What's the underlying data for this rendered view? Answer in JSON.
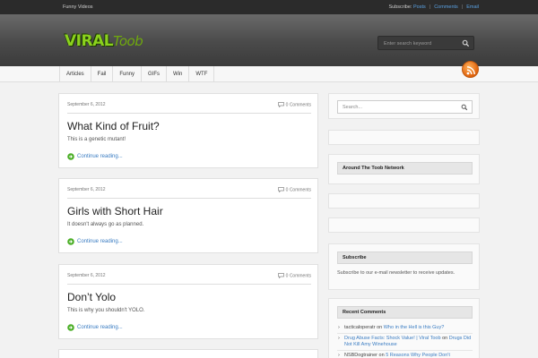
{
  "topbar": {
    "site_tag": "Funny Videos",
    "subscribe_label": "Subscribe:",
    "links": [
      "Posts",
      "Comments",
      "Email"
    ]
  },
  "header": {
    "logo_part1": "VIRAL",
    "logo_part2": "Toob",
    "search_placeholder": "Enter search keyword"
  },
  "nav": {
    "items": [
      "Articles",
      "Fail",
      "Funny",
      "GIFs",
      "Win",
      "WTF"
    ]
  },
  "posts": [
    {
      "date": "September 6, 2012",
      "comments": "0 Comments",
      "title": "What Kind of Fruit?",
      "excerpt": "This is a genetic mutant!",
      "more": "Continue reading..."
    },
    {
      "date": "September 6, 2012",
      "comments": "0 Comments",
      "title": "Girls with Short Hair",
      "excerpt": "It doesn't always go as planned.",
      "more": "Continue reading..."
    },
    {
      "date": "September 6, 2012",
      "comments": "0 Comments",
      "title": "Don’t Yolo",
      "excerpt": "This is why you shouldn't YOLO.",
      "more": "Continue reading..."
    }
  ],
  "sidebar": {
    "search_placeholder": "Search...",
    "network_title": "Around The Toob Network",
    "subscribe_title": "Subscribe",
    "subscribe_text": "Subscribe to our e-mail newsletter to receive updates.",
    "recent_comments_title": "Recent Comments",
    "recent_comments": [
      {
        "author": "tacticaloperatr",
        "on": "on",
        "link": "Who in the Hell is this Guy?"
      },
      {
        "author": "",
        "on": "",
        "link": "Drug Abuse Facts: Shock Value! | Viral Toob",
        "suffix": "on",
        "link2": "Drugs Did Not Kill Amy Winehouse"
      },
      {
        "author": "NSBDogtrainer",
        "on": "on",
        "link": "5 Reasons Why People Don't"
      }
    ]
  },
  "colors": {
    "accent_link": "#3a7cc2",
    "logo_green": "#8bd11e",
    "rss_orange": "#e0620c",
    "topbar_bg": "#2b2b2b"
  }
}
